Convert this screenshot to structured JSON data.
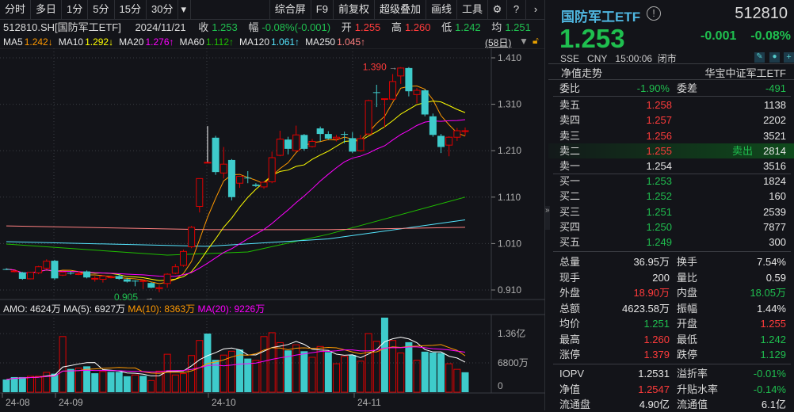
{
  "toolbar": {
    "items": [
      "分时",
      "多日",
      "1分",
      "5分",
      "15分",
      "30分"
    ],
    "dropdown": "▾",
    "right_items": [
      "综合屏",
      "F9",
      "前复权",
      "超级叠加",
      "画线",
      "工具"
    ]
  },
  "info": {
    "symbol": "512810.SH[国防军工ETF]",
    "date": "2024/11/21",
    "close_label": "收",
    "close": "1.253",
    "chg_label": "幅",
    "chg": "-0.08%(-0.001)",
    "open_label": "开",
    "open": "1.255",
    "high_label": "高",
    "high": "1.260",
    "low_label": "低",
    "low": "1.242",
    "avg_label": "均",
    "avg": "1.251"
  },
  "ma": [
    {
      "label": "MA5",
      "value": "1.242↓",
      "color": "#ff9900"
    },
    {
      "label": "MA10",
      "value": "1.292↓",
      "color": "#ffff00"
    },
    {
      "label": "MA20",
      "value": "1.276↑",
      "color": "#ff00ff"
    },
    {
      "label": "MA60",
      "value": "1.112↑",
      "color": "#1fbf00"
    },
    {
      "label": "MA120",
      "value": "1.061↑",
      "color": "#55e6ff"
    },
    {
      "label": "MA250",
      "value": "1.045↑",
      "color": "#ff8080"
    }
  ],
  "period_label": "(58日)",
  "colors": {
    "up": "#e00000",
    "down": "#3ecbcb",
    "axis": "#9a9a9a"
  },
  "chart_data": [
    {
      "type": "candlestick",
      "title": "512810.SH 日K",
      "ylim": [
        0.88,
        1.43
      ],
      "y_ticks": [
        "1.410",
        "1.310",
        "1.210",
        "1.110",
        "1.010",
        "0.910"
      ],
      "y_tick_values": [
        1.41,
        1.31,
        1.21,
        1.11,
        1.01,
        0.91
      ],
      "annotations": {
        "high": "1.390",
        "low": "0.905"
      },
      "ohlc": [
        [
          0.955,
          0.957,
          0.953,
          0.955
        ],
        [
          0.951,
          0.953,
          0.948,
          0.951
        ],
        [
          0.948,
          0.949,
          0.932,
          0.934
        ],
        [
          0.934,
          0.949,
          0.933,
          0.948
        ],
        [
          0.947,
          0.962,
          0.944,
          0.96
        ],
        [
          0.957,
          0.976,
          0.955,
          0.972
        ],
        [
          0.973,
          0.975,
          0.932,
          0.935
        ],
        [
          0.942,
          0.95,
          0.94,
          0.948
        ],
        [
          0.947,
          0.95,
          0.943,
          0.947
        ],
        [
          0.945,
          0.95,
          0.942,
          0.945
        ],
        [
          0.95,
          0.952,
          0.935,
          0.937
        ],
        [
          0.935,
          0.94,
          0.928,
          0.935
        ],
        [
          0.933,
          0.942,
          0.926,
          0.94
        ],
        [
          0.938,
          0.941,
          0.935,
          0.938
        ],
        [
          0.94,
          0.945,
          0.932,
          0.934
        ],
        [
          0.933,
          0.936,
          0.926,
          0.928
        ],
        [
          0.93,
          0.931,
          0.918,
          0.93
        ],
        [
          0.93,
          0.932,
          0.912,
          0.93
        ],
        [
          0.925,
          0.927,
          0.914,
          0.915
        ],
        [
          0.913,
          0.92,
          0.905,
          0.915
        ],
        [
          0.924,
          0.946,
          0.915,
          0.944
        ],
        [
          0.946,
          0.966,
          0.944,
          0.96
        ],
        [
          0.963,
          0.997,
          0.96,
          0.993
        ],
        [
          1.003,
          1.048,
          1.0,
          1.045
        ],
        [
          1.09,
          1.15,
          1.077,
          1.15
        ],
        [
          1.185,
          1.263,
          1.183,
          1.185
        ],
        [
          1.238,
          1.242,
          1.158,
          1.164
        ],
        [
          1.162,
          1.218,
          1.15,
          1.181
        ],
        [
          1.19,
          1.192,
          1.103,
          1.11
        ],
        [
          1.14,
          1.156,
          1.13,
          1.155
        ],
        [
          1.152,
          1.166,
          1.14,
          1.152
        ],
        [
          1.137,
          1.14,
          1.132,
          1.134
        ],
        [
          1.132,
          1.144,
          1.128,
          1.142
        ],
        [
          1.143,
          1.208,
          1.14,
          1.195
        ],
        [
          1.2,
          1.253,
          1.198,
          1.235
        ],
        [
          1.234,
          1.24,
          1.202,
          1.214
        ],
        [
          1.21,
          1.264,
          1.208,
          1.244
        ],
        [
          1.244,
          1.246,
          1.21,
          1.214
        ],
        [
          1.219,
          1.235,
          1.217,
          1.23
        ],
        [
          1.258,
          1.262,
          1.23,
          1.246
        ],
        [
          1.246,
          1.252,
          1.234,
          1.236
        ],
        [
          1.236,
          1.244,
          1.23,
          1.239
        ],
        [
          1.246,
          1.251,
          1.226,
          1.246
        ],
        [
          1.237,
          1.25,
          1.205,
          1.208
        ],
        [
          1.21,
          1.244,
          1.208,
          1.236
        ],
        [
          1.246,
          1.32,
          1.244,
          1.318
        ],
        [
          1.336,
          1.352,
          1.304,
          1.336
        ],
        [
          1.322,
          1.322,
          1.26,
          1.322
        ],
        [
          1.321,
          1.375,
          1.319,
          1.359
        ],
        [
          1.371,
          1.39,
          1.354,
          1.388
        ],
        [
          1.388,
          1.39,
          1.327,
          1.338
        ],
        [
          1.331,
          1.345,
          1.312,
          1.34
        ],
        [
          1.34,
          1.342,
          1.284,
          1.288
        ],
        [
          1.284,
          1.29,
          1.24,
          1.244
        ],
        [
          1.242,
          1.246,
          1.205,
          1.218
        ],
        [
          1.222,
          1.241,
          1.198,
          1.239
        ],
        [
          1.239,
          1.259,
          1.231,
          1.253
        ],
        [
          1.253,
          1.26,
          1.242,
          1.253
        ]
      ],
      "ma_long": {
        "MA60": [
          [
            0,
            1.009
          ],
          [
            20,
            0.985
          ],
          [
            30,
            0.992
          ],
          [
            40,
            1.03
          ],
          [
            57,
            1.11
          ]
        ],
        "MA120": [
          [
            0,
            1.014
          ],
          [
            25,
            1.004
          ],
          [
            40,
            1.02
          ],
          [
            57,
            1.061
          ]
        ],
        "MA250": [
          [
            0,
            1.048
          ],
          [
            25,
            1.04
          ],
          [
            40,
            1.04
          ],
          [
            57,
            1.045
          ]
        ]
      }
    },
    {
      "type": "bar",
      "title": "AMO",
      "unit": "万",
      "ylim": [
        0,
        17500
      ],
      "y_ticks": [
        "1.36亿",
        "6800万",
        "0"
      ],
      "y_tick_values": [
        13600,
        6800,
        0
      ],
      "values": [
        2940,
        3500,
        3500,
        3680,
        3680,
        4600,
        4300,
        12900,
        5400,
        5600,
        6000,
        4400,
        4800,
        4700,
        4700,
        3700,
        4000,
        3800,
        2700,
        4900,
        8800,
        4000,
        4300,
        8500,
        12000,
        13600,
        7500,
        8600,
        9500,
        9900,
        7800,
        7400,
        12900,
        13800,
        11500,
        9700,
        11000,
        9500,
        8100,
        10600,
        9300,
        6600,
        8300,
        8600,
        7200,
        13600,
        11800,
        17300,
        12000,
        9100,
        11600,
        7400,
        9400,
        9200,
        9100,
        6600,
        5300,
        4624
      ],
      "up": [
        false,
        false,
        false,
        true,
        true,
        true,
        false,
        true,
        false,
        true,
        false,
        false,
        true,
        false,
        false,
        false,
        true,
        false,
        true,
        true,
        true,
        true,
        true,
        true,
        true,
        false,
        false,
        true,
        true,
        false,
        false,
        true,
        true,
        true,
        true,
        false,
        true,
        false,
        true,
        true,
        false,
        true,
        true,
        false,
        true,
        true,
        true,
        false,
        true,
        true,
        false,
        true,
        false,
        false,
        false,
        true,
        true,
        false
      ],
      "x_labels": [
        "24-08",
        "24-09",
        "24-10",
        "24-11"
      ]
    }
  ],
  "volume_header": {
    "amo": "AMO: 4624万",
    "ma5": "MA(5): 6927万",
    "ma10": "MA(10): 8363万",
    "ma20": "MA(20): 9226万"
  },
  "right": {
    "name": "国防军工ETF",
    "code": "512810",
    "price": "1.253",
    "change": "-0.001",
    "change_pct": "-0.08%",
    "exchange": "SSE",
    "currency": "CNY",
    "time": "15:00:06",
    "status": "闭市",
    "nav_trend": "净值走势",
    "fund_name": "华宝中证军工ETF",
    "wei": {
      "l1": "委比",
      "v1": "-1.90%",
      "l2": "委差",
      "v2": "-491"
    },
    "asks": [
      {
        "label": "卖五",
        "price": "1.258",
        "vol": "1138"
      },
      {
        "label": "卖四",
        "price": "1.257",
        "vol": "2202"
      },
      {
        "label": "卖三",
        "price": "1.256",
        "vol": "3521"
      },
      {
        "label": "卖二",
        "price": "1.255",
        "vol": "2814",
        "tag": "卖出"
      },
      {
        "label": "卖一",
        "price": "1.254",
        "vol": "3516"
      }
    ],
    "bids": [
      {
        "label": "买一",
        "price": "1.253",
        "vol": "1824"
      },
      {
        "label": "买二",
        "price": "1.252",
        "vol": "160"
      },
      {
        "label": "买三",
        "price": "1.251",
        "vol": "2539"
      },
      {
        "label": "买四",
        "price": "1.250",
        "vol": "7877"
      },
      {
        "label": "买五",
        "price": "1.249",
        "vol": "300"
      }
    ],
    "stats": [
      {
        "l1": "总量",
        "v1": "36.95万",
        "c1": "w",
        "l2": "换手",
        "v2": "7.54%",
        "c2": "w"
      },
      {
        "l1": "现手",
        "v1": "200",
        "c1": "w",
        "l2": "量比",
        "v2": "0.59",
        "c2": "w"
      },
      {
        "l1": "外盘",
        "v1": "18.90万",
        "c1": "r",
        "l2": "内盘",
        "v2": "18.05万",
        "c2": "g"
      },
      {
        "l1": "总额",
        "v1": "4623.58万",
        "c1": "w",
        "l2": "振幅",
        "v2": "1.44%",
        "c2": "w"
      },
      {
        "l1": "均价",
        "v1": "1.251",
        "c1": "g",
        "l2": "开盘",
        "v2": "1.255",
        "c2": "r"
      },
      {
        "l1": "最高",
        "v1": "1.260",
        "c1": "r",
        "l2": "最低",
        "v2": "1.242",
        "c2": "g"
      },
      {
        "l1": "涨停",
        "v1": "1.379",
        "c1": "r",
        "l2": "跌停",
        "v2": "1.129",
        "c2": "g"
      }
    ],
    "etf": [
      {
        "l1": "IOPV",
        "v1": "1.2531",
        "c1": "w",
        "l2": "溢折率",
        "v2": "-0.01%",
        "c2": "g"
      },
      {
        "l1": "净值",
        "v1": "1.2547",
        "c1": "r",
        "l2": "升贴水率",
        "v2": "-0.14%",
        "c2": "g"
      },
      {
        "l1": "流通盘",
        "v1": "4.90亿",
        "c1": "w",
        "l2": "流通值",
        "v2": "6.1亿",
        "c2": "w"
      }
    ]
  }
}
